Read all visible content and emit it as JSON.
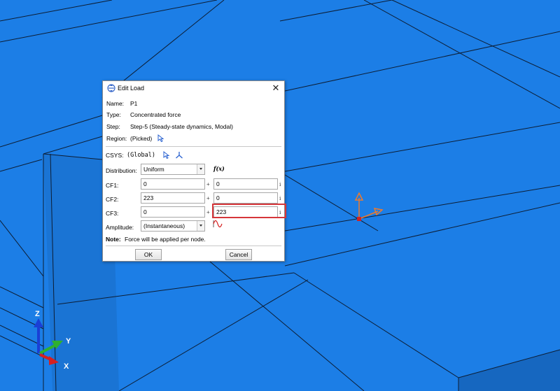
{
  "dialog": {
    "title": "Edit Load",
    "name_label": "Name:",
    "name_value": "P1",
    "type_label": "Type:",
    "type_value": "Concentrated force",
    "step_label": "Step:",
    "step_value": "Step-5 (Steady-state dynamics, Modal)",
    "region_label": "Region:",
    "region_value": "(Picked)",
    "csys_label": "CSYS:",
    "csys_value": "(Global)",
    "distribution_label": "Distribution:",
    "distribution_value": "Uniform",
    "fx_label": "f(x)",
    "rows": [
      {
        "label": "CF1:",
        "real": "0",
        "imag": "0"
      },
      {
        "label": "CF2:",
        "real": "223",
        "imag": "0"
      },
      {
        "label": "CF3:",
        "real": "0",
        "imag": "223"
      }
    ],
    "plus": "+",
    "imag_unit": "i",
    "amplitude_label": "Amplitude:",
    "amplitude_value": "(Instantaneous)",
    "note_label": "Note:",
    "note_text": "Force will be applied per node.",
    "ok_label": "OK",
    "cancel_label": "Cancel"
  },
  "triad": {
    "z": "Z",
    "y": "Y",
    "x": "X"
  },
  "colors": {
    "background": "#1c7ee6",
    "edge": "#0d1d33",
    "highlight": "#d6363a",
    "load_arrow": "#f07a2a",
    "axis_z": "#1a3fd6",
    "axis_y": "#2fb02f",
    "axis_x": "#d62020"
  }
}
